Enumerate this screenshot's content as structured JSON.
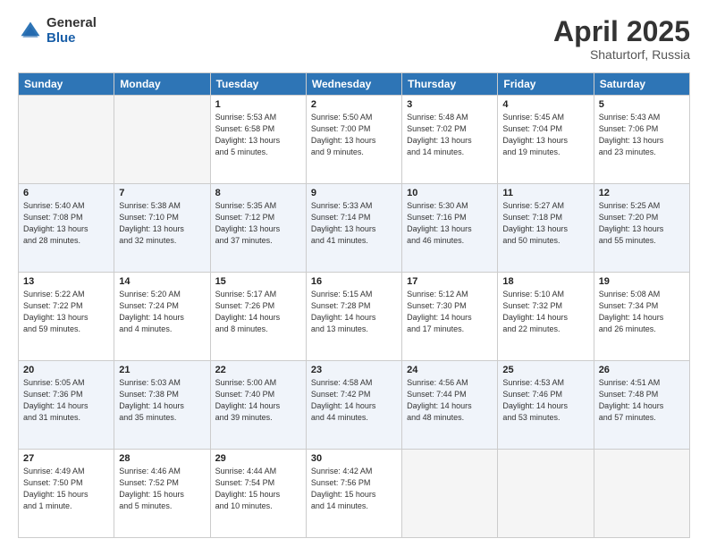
{
  "header": {
    "logo_general": "General",
    "logo_blue": "Blue",
    "title": "April 2025",
    "subtitle": "Shaturtorf, Russia"
  },
  "days_of_week": [
    "Sunday",
    "Monday",
    "Tuesday",
    "Wednesday",
    "Thursday",
    "Friday",
    "Saturday"
  ],
  "weeks": [
    [
      {
        "day": "",
        "info": ""
      },
      {
        "day": "",
        "info": ""
      },
      {
        "day": "1",
        "info": "Sunrise: 5:53 AM\nSunset: 6:58 PM\nDaylight: 13 hours\nand 5 minutes."
      },
      {
        "day": "2",
        "info": "Sunrise: 5:50 AM\nSunset: 7:00 PM\nDaylight: 13 hours\nand 9 minutes."
      },
      {
        "day": "3",
        "info": "Sunrise: 5:48 AM\nSunset: 7:02 PM\nDaylight: 13 hours\nand 14 minutes."
      },
      {
        "day": "4",
        "info": "Sunrise: 5:45 AM\nSunset: 7:04 PM\nDaylight: 13 hours\nand 19 minutes."
      },
      {
        "day": "5",
        "info": "Sunrise: 5:43 AM\nSunset: 7:06 PM\nDaylight: 13 hours\nand 23 minutes."
      }
    ],
    [
      {
        "day": "6",
        "info": "Sunrise: 5:40 AM\nSunset: 7:08 PM\nDaylight: 13 hours\nand 28 minutes."
      },
      {
        "day": "7",
        "info": "Sunrise: 5:38 AM\nSunset: 7:10 PM\nDaylight: 13 hours\nand 32 minutes."
      },
      {
        "day": "8",
        "info": "Sunrise: 5:35 AM\nSunset: 7:12 PM\nDaylight: 13 hours\nand 37 minutes."
      },
      {
        "day": "9",
        "info": "Sunrise: 5:33 AM\nSunset: 7:14 PM\nDaylight: 13 hours\nand 41 minutes."
      },
      {
        "day": "10",
        "info": "Sunrise: 5:30 AM\nSunset: 7:16 PM\nDaylight: 13 hours\nand 46 minutes."
      },
      {
        "day": "11",
        "info": "Sunrise: 5:27 AM\nSunset: 7:18 PM\nDaylight: 13 hours\nand 50 minutes."
      },
      {
        "day": "12",
        "info": "Sunrise: 5:25 AM\nSunset: 7:20 PM\nDaylight: 13 hours\nand 55 minutes."
      }
    ],
    [
      {
        "day": "13",
        "info": "Sunrise: 5:22 AM\nSunset: 7:22 PM\nDaylight: 13 hours\nand 59 minutes."
      },
      {
        "day": "14",
        "info": "Sunrise: 5:20 AM\nSunset: 7:24 PM\nDaylight: 14 hours\nand 4 minutes."
      },
      {
        "day": "15",
        "info": "Sunrise: 5:17 AM\nSunset: 7:26 PM\nDaylight: 14 hours\nand 8 minutes."
      },
      {
        "day": "16",
        "info": "Sunrise: 5:15 AM\nSunset: 7:28 PM\nDaylight: 14 hours\nand 13 minutes."
      },
      {
        "day": "17",
        "info": "Sunrise: 5:12 AM\nSunset: 7:30 PM\nDaylight: 14 hours\nand 17 minutes."
      },
      {
        "day": "18",
        "info": "Sunrise: 5:10 AM\nSunset: 7:32 PM\nDaylight: 14 hours\nand 22 minutes."
      },
      {
        "day": "19",
        "info": "Sunrise: 5:08 AM\nSunset: 7:34 PM\nDaylight: 14 hours\nand 26 minutes."
      }
    ],
    [
      {
        "day": "20",
        "info": "Sunrise: 5:05 AM\nSunset: 7:36 PM\nDaylight: 14 hours\nand 31 minutes."
      },
      {
        "day": "21",
        "info": "Sunrise: 5:03 AM\nSunset: 7:38 PM\nDaylight: 14 hours\nand 35 minutes."
      },
      {
        "day": "22",
        "info": "Sunrise: 5:00 AM\nSunset: 7:40 PM\nDaylight: 14 hours\nand 39 minutes."
      },
      {
        "day": "23",
        "info": "Sunrise: 4:58 AM\nSunset: 7:42 PM\nDaylight: 14 hours\nand 44 minutes."
      },
      {
        "day": "24",
        "info": "Sunrise: 4:56 AM\nSunset: 7:44 PM\nDaylight: 14 hours\nand 48 minutes."
      },
      {
        "day": "25",
        "info": "Sunrise: 4:53 AM\nSunset: 7:46 PM\nDaylight: 14 hours\nand 53 minutes."
      },
      {
        "day": "26",
        "info": "Sunrise: 4:51 AM\nSunset: 7:48 PM\nDaylight: 14 hours\nand 57 minutes."
      }
    ],
    [
      {
        "day": "27",
        "info": "Sunrise: 4:49 AM\nSunset: 7:50 PM\nDaylight: 15 hours\nand 1 minute."
      },
      {
        "day": "28",
        "info": "Sunrise: 4:46 AM\nSunset: 7:52 PM\nDaylight: 15 hours\nand 5 minutes."
      },
      {
        "day": "29",
        "info": "Sunrise: 4:44 AM\nSunset: 7:54 PM\nDaylight: 15 hours\nand 10 minutes."
      },
      {
        "day": "30",
        "info": "Sunrise: 4:42 AM\nSunset: 7:56 PM\nDaylight: 15 hours\nand 14 minutes."
      },
      {
        "day": "",
        "info": ""
      },
      {
        "day": "",
        "info": ""
      },
      {
        "day": "",
        "info": ""
      }
    ]
  ]
}
